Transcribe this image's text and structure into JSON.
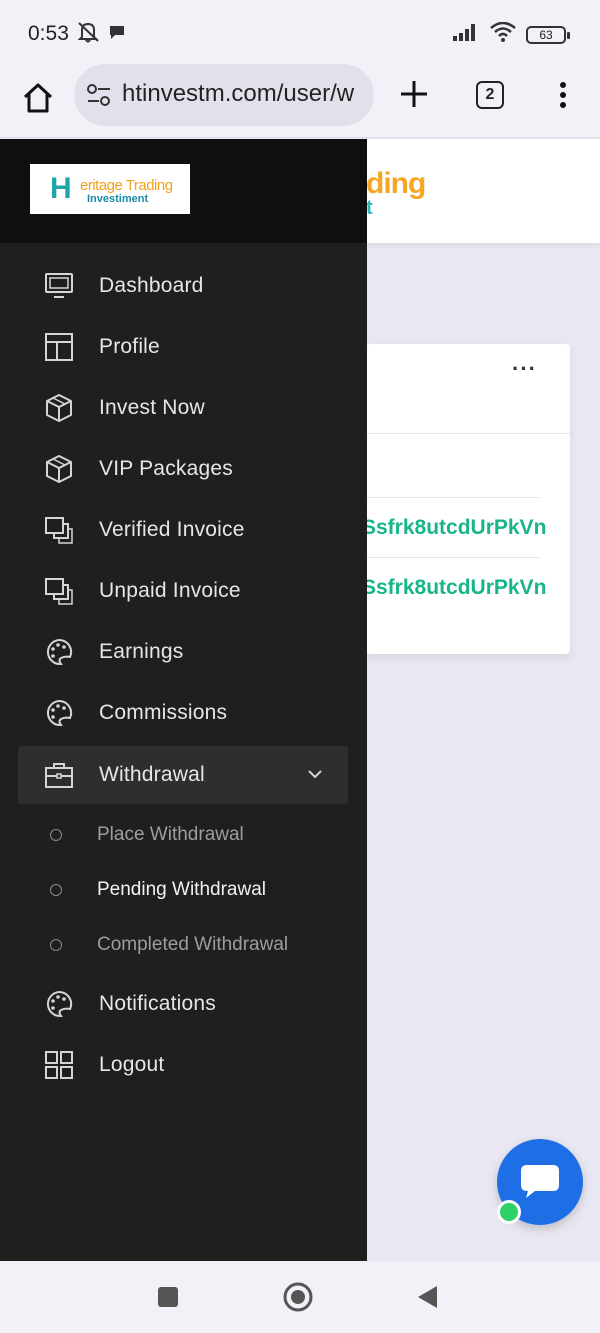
{
  "status_bar": {
    "time": "0:53",
    "battery": "63",
    "icons": [
      "mute-icon",
      "chat-bubble-icon",
      "signal-icon",
      "wifi-icon",
      "battery-icon"
    ]
  },
  "browser": {
    "url": "htinvestm.com/user/w",
    "tab_count": "2"
  },
  "page": {
    "logo_fragment_top": "ding",
    "logo_fragment_bottom": "t",
    "card": {
      "more_label": "···",
      "address_1": "Ssfrk8utcdUrPkVn",
      "address_2": "Ssfrk8utcdUrPkVn"
    }
  },
  "sidebar": {
    "logo": {
      "letter": "H",
      "line1": "eritage Trading",
      "line2": "Investiment"
    },
    "items": [
      {
        "label": "Dashboard",
        "icon": "monitor-icon"
      },
      {
        "label": "Profile",
        "icon": "layout-icon"
      },
      {
        "label": "Invest Now",
        "icon": "box-icon"
      },
      {
        "label": "VIP Packages",
        "icon": "box-icon"
      },
      {
        "label": "Verified Invoice",
        "icon": "copy-icon"
      },
      {
        "label": "Unpaid Invoice",
        "icon": "copy-icon"
      },
      {
        "label": "Earnings",
        "icon": "palette-icon"
      },
      {
        "label": "Commissions",
        "icon": "palette-icon"
      },
      {
        "label": "Withdrawal",
        "icon": "briefcase-icon",
        "expanded": true
      },
      {
        "label": "Notifications",
        "icon": "palette-icon"
      },
      {
        "label": "Logout",
        "icon": "grid-icon"
      }
    ],
    "withdrawal_sub": [
      {
        "label": "Place Withdrawal"
      },
      {
        "label": "Pending Withdrawal",
        "current": true
      },
      {
        "label": "Completed Withdrawal"
      }
    ]
  },
  "colors": {
    "sidebar_bg": "#1f1f20",
    "active_item_bg": "#2e2e30",
    "accent_green": "#19b58a",
    "chat_blue": "#1e6fe6",
    "online_green": "#2fd06a"
  }
}
